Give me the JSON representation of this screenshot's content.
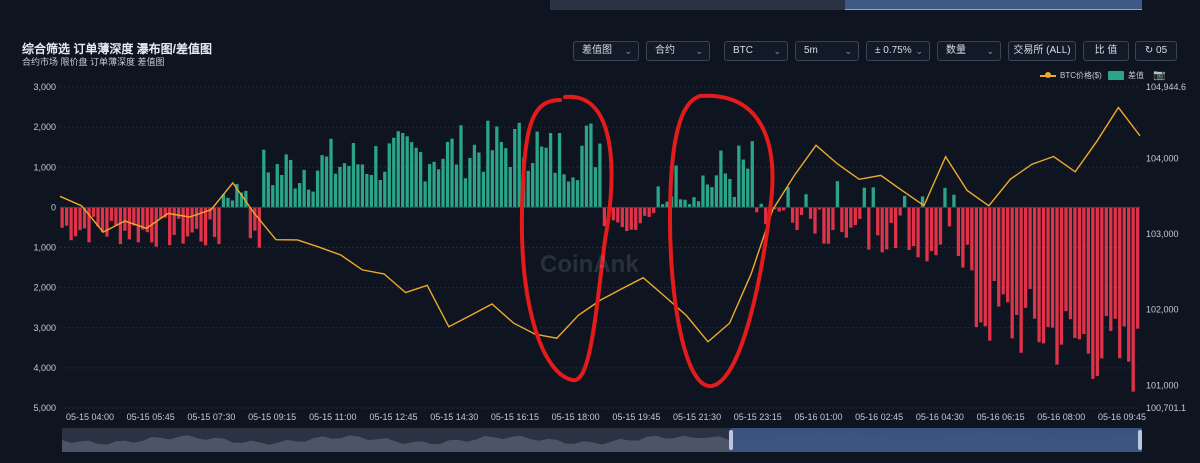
{
  "header": {
    "title": "综合筛选 订单薄深度 瀑布图/差值图",
    "subtitle": "合约市场 限价盘 订单薄深度 差值图"
  },
  "toolbar": {
    "chart_type": "差值图",
    "market": "合约",
    "symbol": "BTC",
    "interval": "5m",
    "range": "± 0.75%",
    "metric": "数量",
    "exchange": "交易所 (ALL)",
    "ratio": "比 值",
    "refresh": "05"
  },
  "legend": {
    "price_label": "BTC价格($)",
    "diff_label": "差值"
  },
  "watermark": "CoinAnk",
  "colors": {
    "positive": "#2aa58a",
    "negative": "#e0334a",
    "price": "#f0a92a",
    "background": "#0e1521",
    "annotation": "#e41b1b"
  },
  "chart_data": {
    "type": "bar",
    "left_axis": {
      "ticks": [
        "3,000",
        "2,000",
        "1,000",
        "0",
        "1,000",
        "2,000",
        "3,000",
        "4,000",
        "5,000"
      ],
      "ylim": [
        -5000,
        3000
      ]
    },
    "right_axis": {
      "ticks": [
        "104,944.6",
        "104,000",
        "103,000",
        "102,000",
        "101,000",
        "100,701.1"
      ],
      "ylim": [
        100701.1,
        104944.6
      ]
    },
    "x_ticks": [
      "05-15 04:00",
      "05-15 05:45",
      "05-15 07:30",
      "05-15 09:15",
      "05-15 11:00",
      "05-15 12:45",
      "05-15 14:30",
      "05-15 16:15",
      "05-15 18:00",
      "05-15 19:45",
      "05-15 21:30",
      "05-15 23:15",
      "05-16 01:00",
      "05-16 02:45",
      "05-16 04:30",
      "05-16 06:15",
      "05-16 08:00",
      "05-16 09:45"
    ],
    "diff_segments": [
      {
        "bars": 36,
        "from": -500,
        "to": -700,
        "noise": 400,
        "sign": "neg"
      },
      {
        "bars": 6,
        "from": 300,
        "to": 500,
        "noise": 300,
        "sign": "pos"
      },
      {
        "bars": 3,
        "from": -600,
        "to": -900,
        "noise": 200,
        "sign": "neg"
      },
      {
        "bars": 62,
        "from": 900,
        "to": 1600,
        "noise": 700,
        "sign": "pos"
      },
      {
        "bars": 14,
        "from": 1200,
        "to": 1600,
        "noise": 800,
        "sign": "pos"
      },
      {
        "bars": 12,
        "from": -200,
        "to": -400,
        "noise": 300,
        "sign": "mixed"
      },
      {
        "bars": 22,
        "from": 300,
        "to": 1000,
        "noise": 800,
        "sign": "pos"
      },
      {
        "bars": 30,
        "from": -300,
        "to": -800,
        "noise": 500,
        "sign": "mixed"
      },
      {
        "bars": 18,
        "from": -400,
        "to": -1200,
        "noise": 600,
        "sign": "mixed"
      },
      {
        "bars": 38,
        "from": -2500,
        "to": -3800,
        "noise": 1000,
        "sign": "neg"
      }
    ],
    "price_series": [
      {
        "x": "05-15 03:45",
        "y": 103500
      },
      {
        "x": "05-15 04:00",
        "y": 103350
      },
      {
        "x": "05-15 04:30",
        "y": 103050
      },
      {
        "x": "05-15 05:00",
        "y": 103150
      },
      {
        "x": "05-15 05:45",
        "y": 103100
      },
      {
        "x": "05-15 06:30",
        "y": 103250
      },
      {
        "x": "05-15 07:30",
        "y": 103250
      },
      {
        "x": "05-15 08:15",
        "y": 103300
      },
      {
        "x": "05-15 08:45",
        "y": 103700
      },
      {
        "x": "05-15 09:15",
        "y": 103250
      },
      {
        "x": "05-15 09:45",
        "y": 102950
      },
      {
        "x": "05-15 10:30",
        "y": 102900
      },
      {
        "x": "05-15 11:00",
        "y": 102850
      },
      {
        "x": "05-15 12:00",
        "y": 102700
      },
      {
        "x": "05-15 12:45",
        "y": 102550
      },
      {
        "x": "05-15 13:30",
        "y": 102450
      },
      {
        "x": "05-15 14:00",
        "y": 102250
      },
      {
        "x": "05-15 14:30",
        "y": 102300
      },
      {
        "x": "05-15 15:15",
        "y": 101800
      },
      {
        "x": "05-15 16:15",
        "y": 101900
      },
      {
        "x": "05-15 16:45",
        "y": 102100
      },
      {
        "x": "05-15 17:30",
        "y": 101800
      },
      {
        "x": "05-15 18:00",
        "y": 101700
      },
      {
        "x": "05-15 18:45",
        "y": 101600
      },
      {
        "x": "05-15 19:15",
        "y": 101950
      },
      {
        "x": "05-15 19:45",
        "y": 102100
      },
      {
        "x": "05-15 20:30",
        "y": 102300
      },
      {
        "x": "05-15 21:15",
        "y": 102400
      },
      {
        "x": "05-15 21:30",
        "y": 102200
      },
      {
        "x": "05-15 22:15",
        "y": 101900
      },
      {
        "x": "05-15 22:45",
        "y": 101600
      },
      {
        "x": "05-15 23:15",
        "y": 101800
      },
      {
        "x": "05-15 23:45",
        "y": 102500
      },
      {
        "x": "05-16 00:15",
        "y": 103300
      },
      {
        "x": "05-16 01:00",
        "y": 103800
      },
      {
        "x": "05-16 01:30",
        "y": 104150
      },
      {
        "x": "05-16 02:00",
        "y": 103950
      },
      {
        "x": "05-16 02:45",
        "y": 103700
      },
      {
        "x": "05-16 03:30",
        "y": 103800
      },
      {
        "x": "05-16 04:30",
        "y": 103550
      },
      {
        "x": "05-16 05:15",
        "y": 103400
      },
      {
        "x": "05-16 05:45",
        "y": 104000
      },
      {
        "x": "05-16 06:15",
        "y": 103600
      },
      {
        "x": "05-16 06:45",
        "y": 103350
      },
      {
        "x": "05-16 07:15",
        "y": 103750
      },
      {
        "x": "05-16 08:00",
        "y": 103900
      },
      {
        "x": "05-16 08:45",
        "y": 104050
      },
      {
        "x": "05-16 09:15",
        "y": 103800
      },
      {
        "x": "05-16 09:45",
        "y": 104250
      },
      {
        "x": "05-16 10:15",
        "y": 104650
      },
      {
        "x": "05-16 10:45",
        "y": 104300
      }
    ],
    "grid": true,
    "legend_position": "top-right"
  }
}
